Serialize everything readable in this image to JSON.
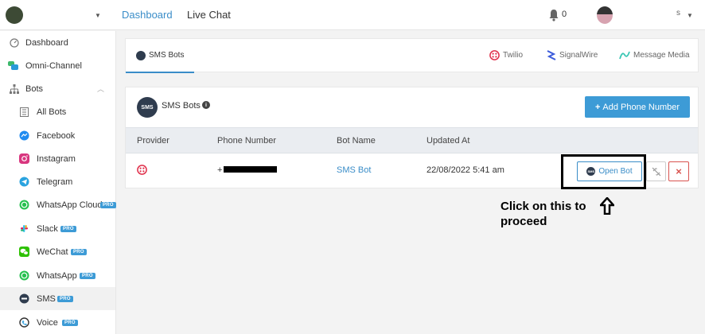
{
  "header": {
    "nav": [
      "Dashboard",
      "Live Chat"
    ],
    "notification_count": "0",
    "user_initial": "s"
  },
  "sidebar": {
    "items": [
      {
        "label": "Dashboard",
        "icon": "dashboard-gauge-icon"
      },
      {
        "label": "Omni-Channel",
        "icon": "omnichannel-chat-icon"
      },
      {
        "label": "Bots",
        "icon": "bots-hierarchy-icon",
        "expanded": true
      },
      {
        "label": "All Bots",
        "icon": "all-bots-icon"
      },
      {
        "label": "Facebook",
        "icon": "messenger-icon"
      },
      {
        "label": "Instagram",
        "icon": "instagram-icon"
      },
      {
        "label": "Telegram",
        "icon": "telegram-icon"
      },
      {
        "label": "WhatsApp Cloud",
        "icon": "whatsapp-icon",
        "badge": "PRO"
      },
      {
        "label": "Slack",
        "icon": "slack-icon",
        "badge": "PRO"
      },
      {
        "label": "WeChat",
        "icon": "wechat-icon",
        "badge": "PRO"
      },
      {
        "label": "WhatsApp",
        "icon": "whatsapp-icon",
        "badge": "PRO"
      },
      {
        "label": "SMS",
        "icon": "sms-icon",
        "badge": "PRO",
        "active": true
      },
      {
        "label": "Voice",
        "icon": "voice-icon",
        "badge": "PRO"
      }
    ]
  },
  "tabs": {
    "active": "SMS Bots",
    "providers": [
      "Twilio",
      "SignalWire",
      "Message Media"
    ]
  },
  "panel": {
    "logo_text": "SMS",
    "title": "SMS Bots",
    "add_button": "Add Phone Number",
    "columns": [
      "Provider",
      "Phone Number",
      "Bot Name",
      "Updated At"
    ],
    "row": {
      "phone_prefix": "+",
      "bot_name": "SMS Bot",
      "updated_at": "22/08/2022 5:41 am",
      "open_button": "Open Bot"
    }
  },
  "annotation": {
    "line1": "Click on this to",
    "line2": "proceed"
  },
  "colors": {
    "accent": "#3a8dc8",
    "primary_button": "#3d9bd6",
    "danger": "#d9534f",
    "twilio": "#e0304b"
  }
}
